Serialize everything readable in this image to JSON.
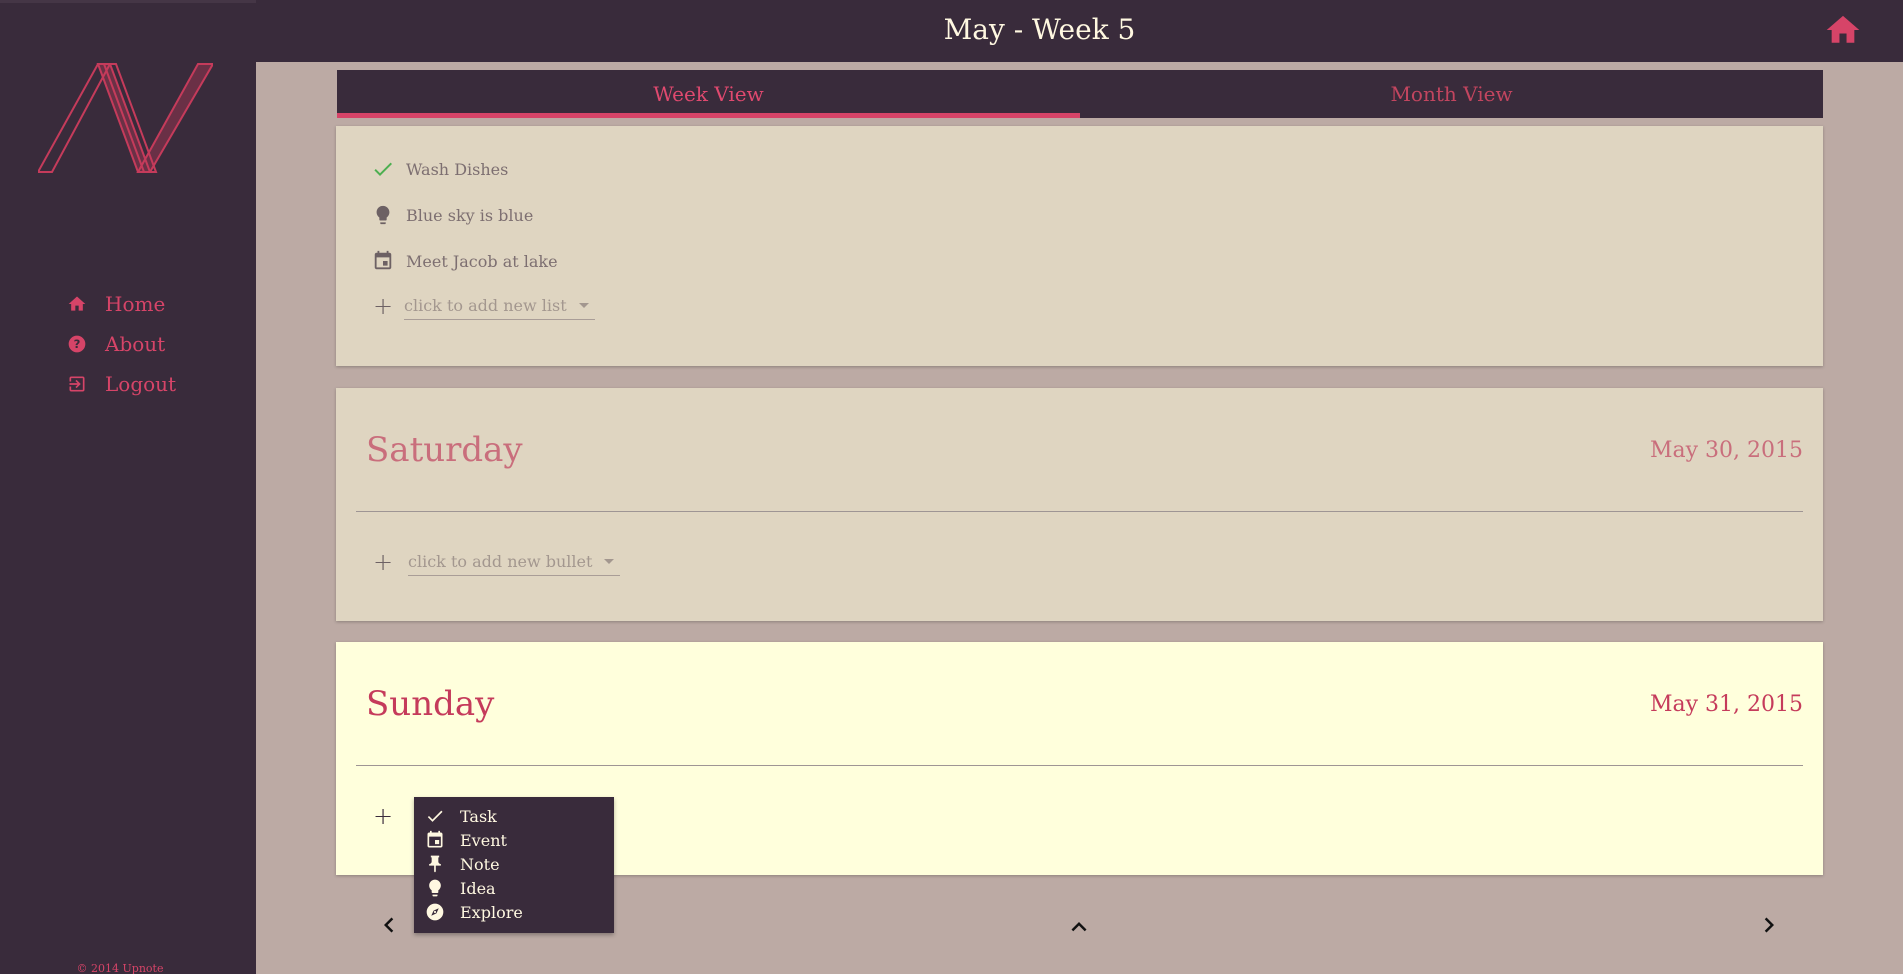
{
  "header": {
    "title": "May - Week 5"
  },
  "sidebar": {
    "items": [
      {
        "label": "Home",
        "icon": "home-icon"
      },
      {
        "label": "About",
        "icon": "help-icon"
      },
      {
        "label": "Logout",
        "icon": "logout-icon"
      }
    ],
    "copyright": "© 2014 Upnote"
  },
  "tabs": [
    {
      "label": "Week View",
      "active": true
    },
    {
      "label": "Month View",
      "active": false
    }
  ],
  "friday_card": {
    "items": [
      {
        "text": "Wash Dishes",
        "icon": "check-icon"
      },
      {
        "text": "Blue sky is blue",
        "icon": "lightbulb-icon"
      },
      {
        "text": "Meet Jacob at lake",
        "icon": "calendar-icon"
      }
    ],
    "add_placeholder": "click to add new list"
  },
  "saturday_card": {
    "day": "Saturday",
    "date": "May 30, 2015",
    "add_placeholder": "click to add new bullet"
  },
  "sunday_card": {
    "day": "Sunday",
    "date": "May 31, 2015"
  },
  "bullet_menu": {
    "items": [
      {
        "label": "Task",
        "icon": "check-icon"
      },
      {
        "label": "Event",
        "icon": "calendar-icon"
      },
      {
        "label": "Note",
        "icon": "pin-icon"
      },
      {
        "label": "Idea",
        "icon": "lightbulb-icon"
      },
      {
        "label": "Explore",
        "icon": "compass-icon"
      }
    ]
  },
  "colors": {
    "accent": "#d64468",
    "dark": "#392b3b",
    "background": "#bcaaa4",
    "past_card": "#dfd5c1",
    "today_card": "#ffffdc"
  }
}
